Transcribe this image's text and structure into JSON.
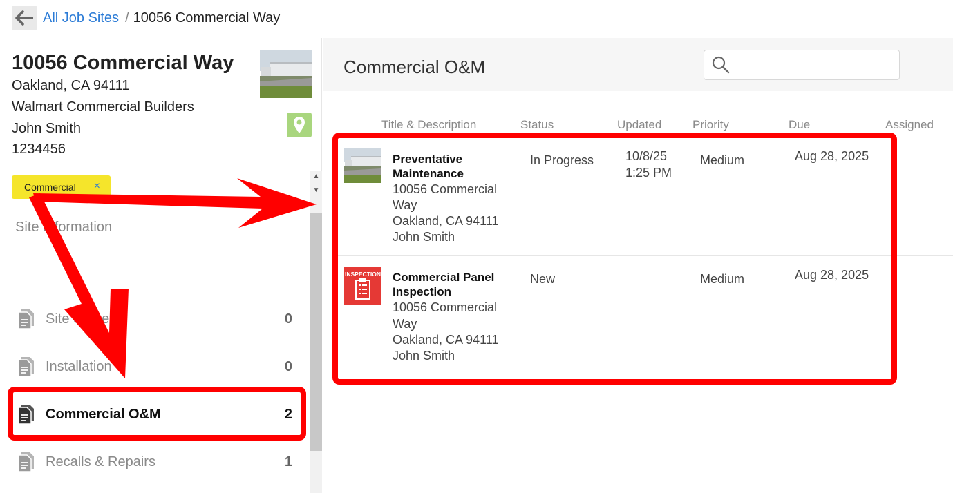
{
  "breadcrumb": {
    "back_label": "",
    "parent": "All Job Sites",
    "separator": "/",
    "current": "10056 Commercial Way"
  },
  "site": {
    "name": "10056 Commercial Way",
    "city_line": "Oakland, CA 94111",
    "company": "Walmart Commercial Builders",
    "contact": "John Smith",
    "number": "1234456",
    "tag": "Commercial",
    "tag_remove": "×",
    "info_label": "Site Information"
  },
  "nav": {
    "items": [
      {
        "label": "Site Surveys",
        "count": "0"
      },
      {
        "label": "Installation",
        "count": "0"
      },
      {
        "label": "Commercial O&M",
        "count": "2"
      },
      {
        "label": "Recalls & Repairs",
        "count": "1"
      }
    ]
  },
  "list": {
    "title": "Commercial O&M",
    "search_placeholder": "",
    "columns": [
      "Title & Description",
      "Status",
      "Updated",
      "Priority",
      "Due",
      "Assigned"
    ],
    "rows": [
      {
        "title": "Preventative Maintenance",
        "addr1": "10056 Commercial",
        "addr2": "Way",
        "addr3": "Oakland, CA 94111",
        "contact": "John Smith",
        "status": "In Progress",
        "updated_date": "10/8/25",
        "updated_time": "1:25 PM",
        "priority": "Medium",
        "due": "Aug 28, 2025",
        "thumb": "building-photo"
      },
      {
        "title": "Commercial Panel Inspection",
        "addr1": "10056 Commercial",
        "addr2": "Way",
        "addr3": "Oakland, CA 94111",
        "contact": "John Smith",
        "status": "New",
        "updated_date": "",
        "updated_time": "",
        "priority": "Medium",
        "due": "Aug 28, 2025",
        "thumb": "inspection-icon",
        "thumb_label": "INSPECTION"
      }
    ]
  },
  "colors": {
    "accent": "#2b7bd6",
    "tag": "#f5e52b",
    "map_button": "#a9d67e",
    "inspection": "#e53935",
    "annotation": "#ff0000"
  },
  "icons": {
    "back": "arrow-left-icon",
    "map": "map-pin-icon",
    "search": "search-icon",
    "nav": "document-icon"
  }
}
